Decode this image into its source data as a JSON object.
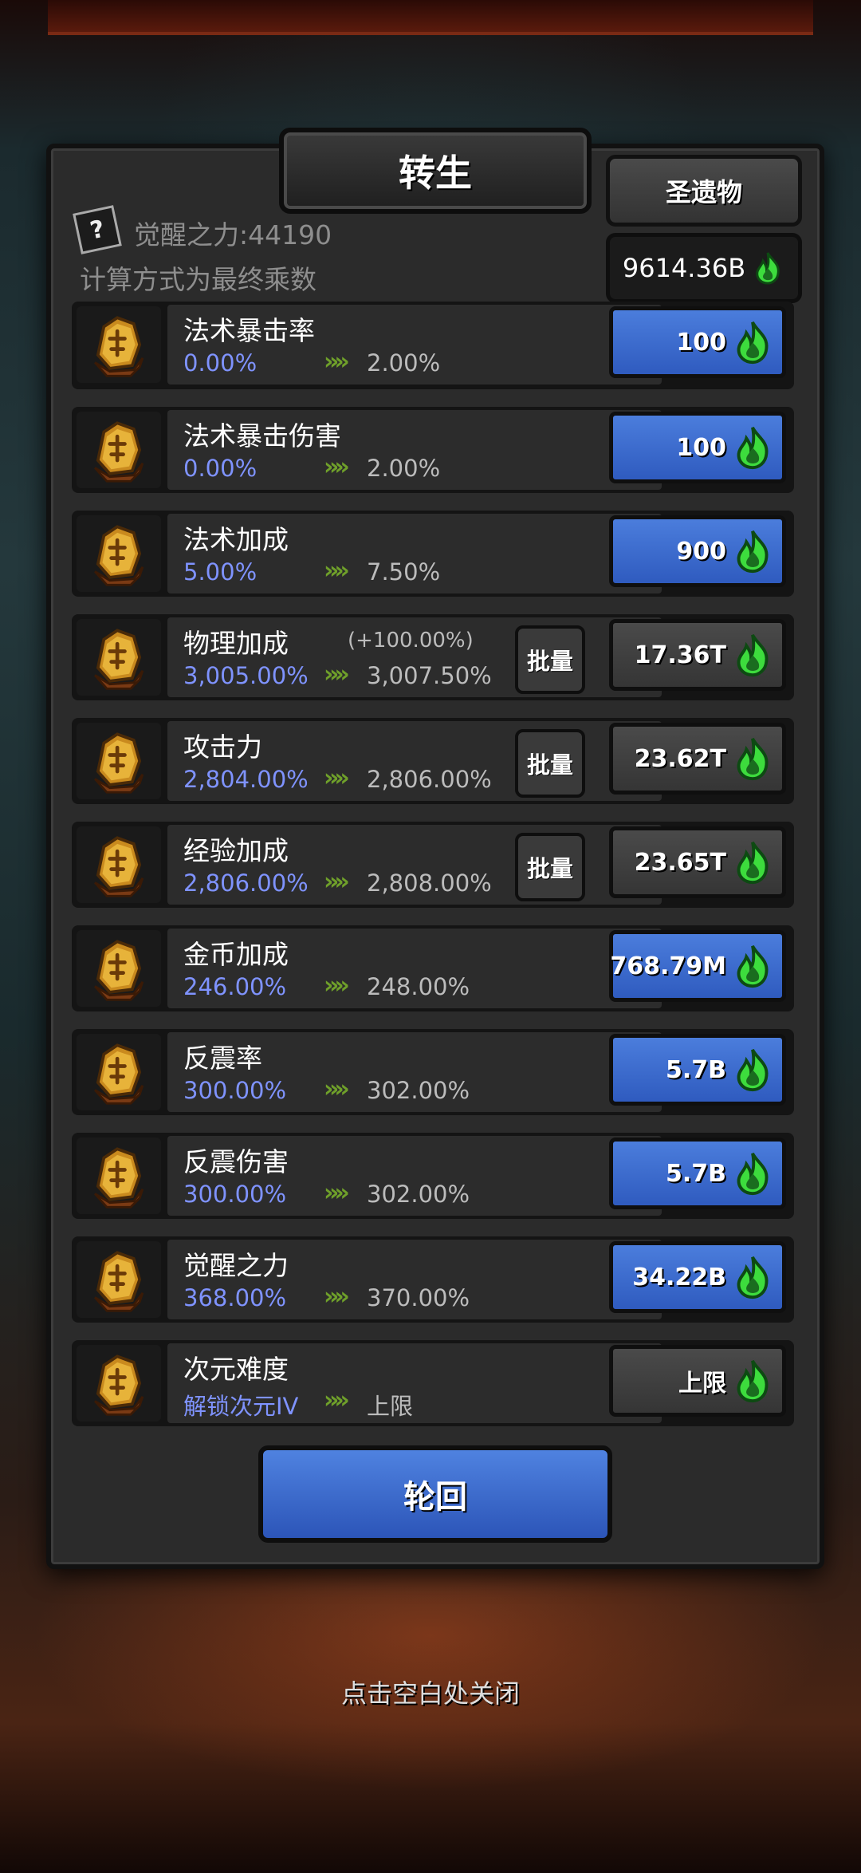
{
  "title": "转生",
  "relic_button": "圣遗物",
  "currency": "9614.36B",
  "help_icon_glyph": "?",
  "awaken_power": "觉醒之力:44190",
  "calc_note": "计算方式为最终乘数",
  "colors": {
    "blue_button": "#3b6bd0",
    "blue_text": "#7f93ff",
    "arrow_green": "#6fa02a",
    "flame_green": "#3ddc3d"
  },
  "rows": [
    {
      "name": "法术暴击率",
      "current": "0.00%",
      "next": "2.00%",
      "bonus": "",
      "batch": "",
      "cost": "100",
      "cost_style": "blue",
      "icon": "rune-stone-icon"
    },
    {
      "name": "法术暴击伤害",
      "current": "0.00%",
      "next": "2.00%",
      "bonus": "",
      "batch": "",
      "cost": "100",
      "cost_style": "blue",
      "icon": "rune-stone-icon"
    },
    {
      "name": "法术加成",
      "current": "5.00%",
      "next": "7.50%",
      "bonus": "",
      "batch": "",
      "cost": "900",
      "cost_style": "blue",
      "icon": "rune-stone-icon"
    },
    {
      "name": "物理加成",
      "current": "3,005.00%",
      "next": "3,007.50%",
      "bonus": "(+100.00%)",
      "batch": "批量",
      "cost": "17.36T",
      "cost_style": "gray",
      "icon": "rune-stone-icon"
    },
    {
      "name": "攻击力",
      "current": "2,804.00%",
      "next": "2,806.00%",
      "bonus": "",
      "batch": "批量",
      "cost": "23.62T",
      "cost_style": "gray",
      "icon": "rune-stone-icon"
    },
    {
      "name": "经验加成",
      "current": "2,806.00%",
      "next": "2,808.00%",
      "bonus": "",
      "batch": "批量",
      "cost": "23.65T",
      "cost_style": "gray",
      "icon": "rune-stone-icon"
    },
    {
      "name": "金币加成",
      "current": "246.00%",
      "next": "248.00%",
      "bonus": "",
      "batch": "",
      "cost": "768.79M",
      "cost_style": "blue",
      "icon": "rune-stone-icon"
    },
    {
      "name": "反震率",
      "current": "300.00%",
      "next": "302.00%",
      "bonus": "",
      "batch": "",
      "cost": "5.7B",
      "cost_style": "blue",
      "icon": "rune-stone-icon"
    },
    {
      "name": "反震伤害",
      "current": "300.00%",
      "next": "302.00%",
      "bonus": "",
      "batch": "",
      "cost": "5.7B",
      "cost_style": "blue",
      "icon": "rune-stone-icon"
    },
    {
      "name": "觉醒之力",
      "current": "368.00%",
      "next": "370.00%",
      "bonus": "",
      "batch": "",
      "cost": "34.22B",
      "cost_style": "blue",
      "icon": "rune-stone-icon"
    },
    {
      "name": "次元难度",
      "current": "解锁次元IV",
      "next": "上限",
      "bonus": "",
      "batch": "",
      "cost": "上限",
      "cost_style": "gray",
      "icon": "rune-stone-icon"
    }
  ],
  "arrow_glyph": "»",
  "reincarnate_button": "轮回",
  "close_hint": "点击空白处关闭"
}
